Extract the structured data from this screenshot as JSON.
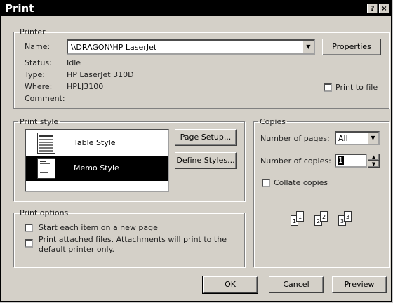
{
  "window": {
    "title": "Print",
    "help_label": "?",
    "close_label": "×"
  },
  "printer": {
    "legend": "Printer",
    "name_label": "Name:",
    "name_value": "\\\\DRAGON\\HP LaserJet",
    "properties_label": "Properties",
    "status_label": "Status:",
    "status_value": "Idle",
    "type_label": "Type:",
    "type_value": "HP LaserJet 310D",
    "where_label": "Where:",
    "where_value": "HPLJ3100",
    "comment_label": "Comment:",
    "comment_value": "",
    "print_to_file_label": "Print to file",
    "print_to_file_checked": false
  },
  "print_style": {
    "legend": "Print style",
    "items": [
      {
        "label": "Table Style",
        "selected": false,
        "icon": "table-style-icon"
      },
      {
        "label": "Memo Style",
        "selected": true,
        "icon": "memo-style-icon"
      }
    ],
    "page_setup_label": "Page Setup...",
    "define_styles_label": "Define Styles..."
  },
  "copies": {
    "legend": "Copies",
    "pages_label": "Number of pages:",
    "pages_value": "All",
    "copies_label": "Number of copies:",
    "copies_value": "1",
    "collate_label": "Collate copies",
    "collate_checked": false,
    "collate_pages": [
      "1",
      "1",
      "2",
      "2",
      "3",
      "3"
    ]
  },
  "print_options": {
    "legend": "Print options",
    "new_page_label": "Start each item on a new page",
    "new_page_checked": false,
    "attached_label_line1": "Print attached files.  Attachments will print to the",
    "attached_label_line2": "default printer only.",
    "attached_checked": false
  },
  "buttons": {
    "ok": "OK",
    "cancel": "Cancel",
    "preview": "Preview"
  }
}
